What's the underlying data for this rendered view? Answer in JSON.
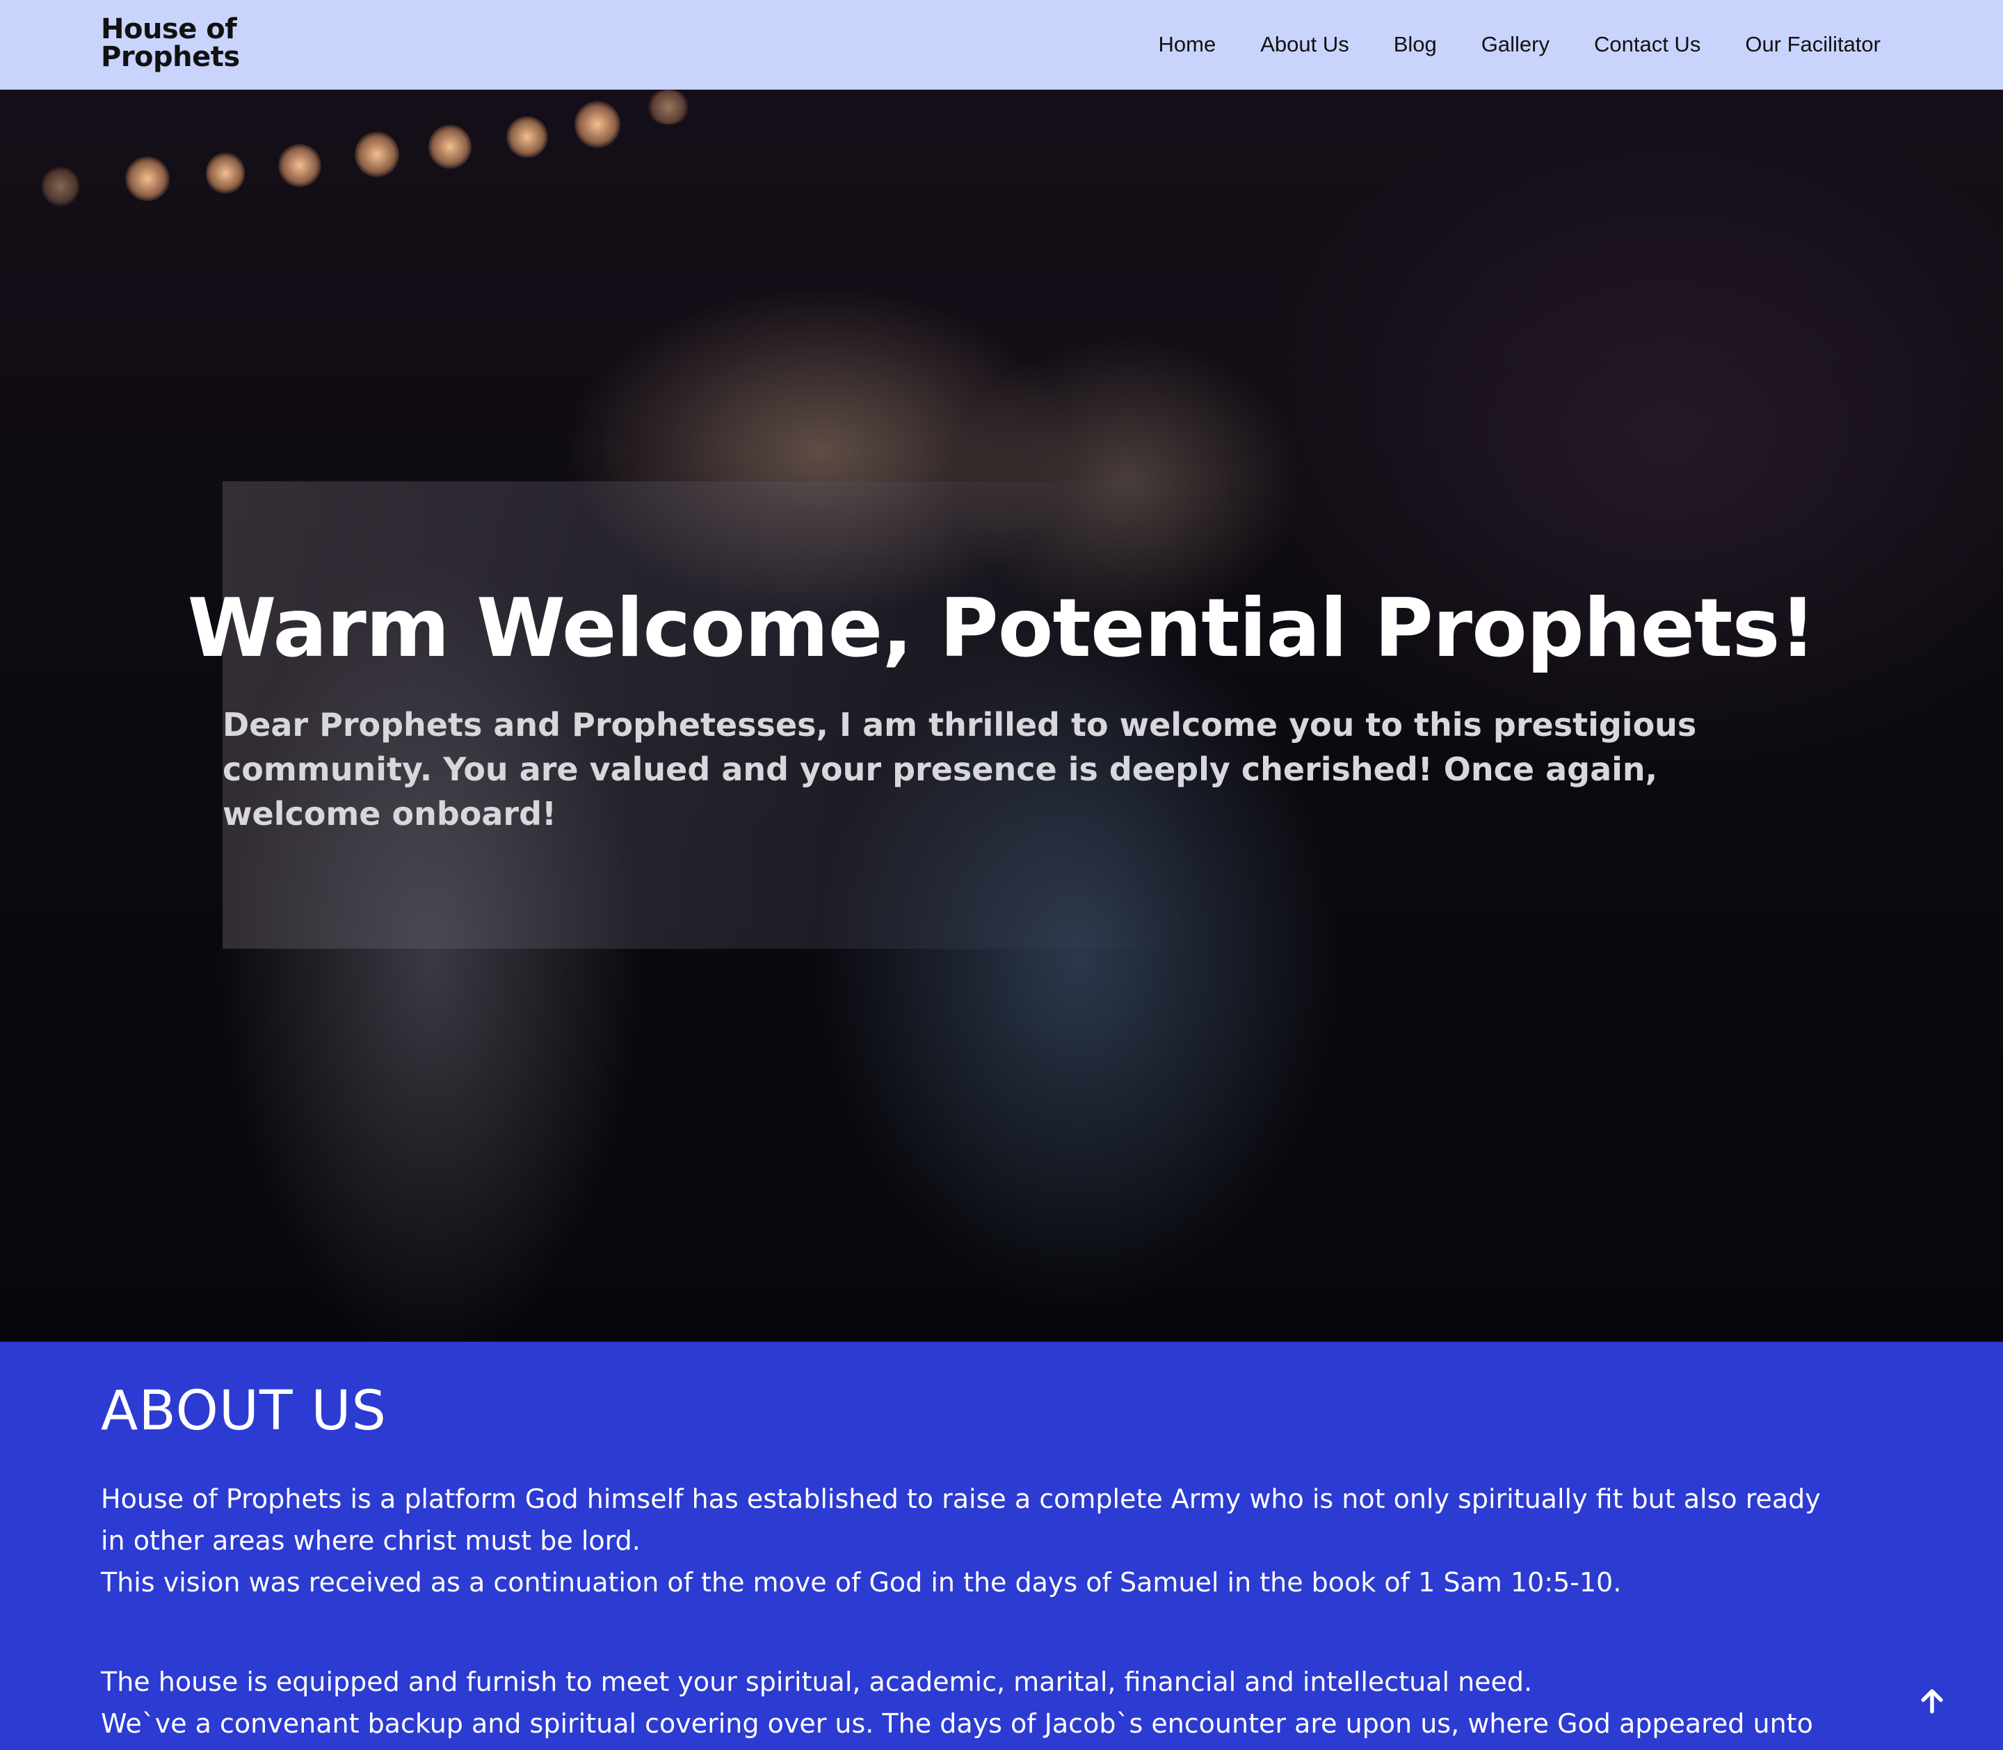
{
  "header": {
    "logo_line1": "House of",
    "logo_line2": "Prophets",
    "nav": [
      "Home",
      "About Us",
      "Blog",
      "Gallery",
      "Contact Us",
      "Our Facilitator"
    ]
  },
  "hero": {
    "title": "Warm Welcome, Potential Prophets!",
    "subtitle": "Dear Prophets and Prophetesses, I am thrilled to welcome you to this prestigious community. You are valued and your presence is deeply cherished! Once again, welcome onboard!"
  },
  "about": {
    "heading": "ABOUT US",
    "para1_line1": "House of Prophets is a platform God himself has established to raise a complete Army who is not only spiritually fit but also ready",
    "para1_line2": "in other areas where christ must be lord.",
    "para1_line3": "This vision was received as a continuation of the move of God in the days of Samuel in the book of 1 Sam 10:5-10.",
    "para2_line1": "The house is equipped and furnish to meet your spiritual, academic, marital, financial and intellectual need.",
    "para2_line2": "We`ve a convenant backup and spiritual covering over us. The days of Jacob`s encounter are upon us, where God appeared unto"
  },
  "icons": {
    "scroll_top": "arrow-up-icon"
  },
  "colors": {
    "nav_background": "#c9d4fc",
    "about_background": "#2c3bd1",
    "hero_title": "#ffffff"
  }
}
